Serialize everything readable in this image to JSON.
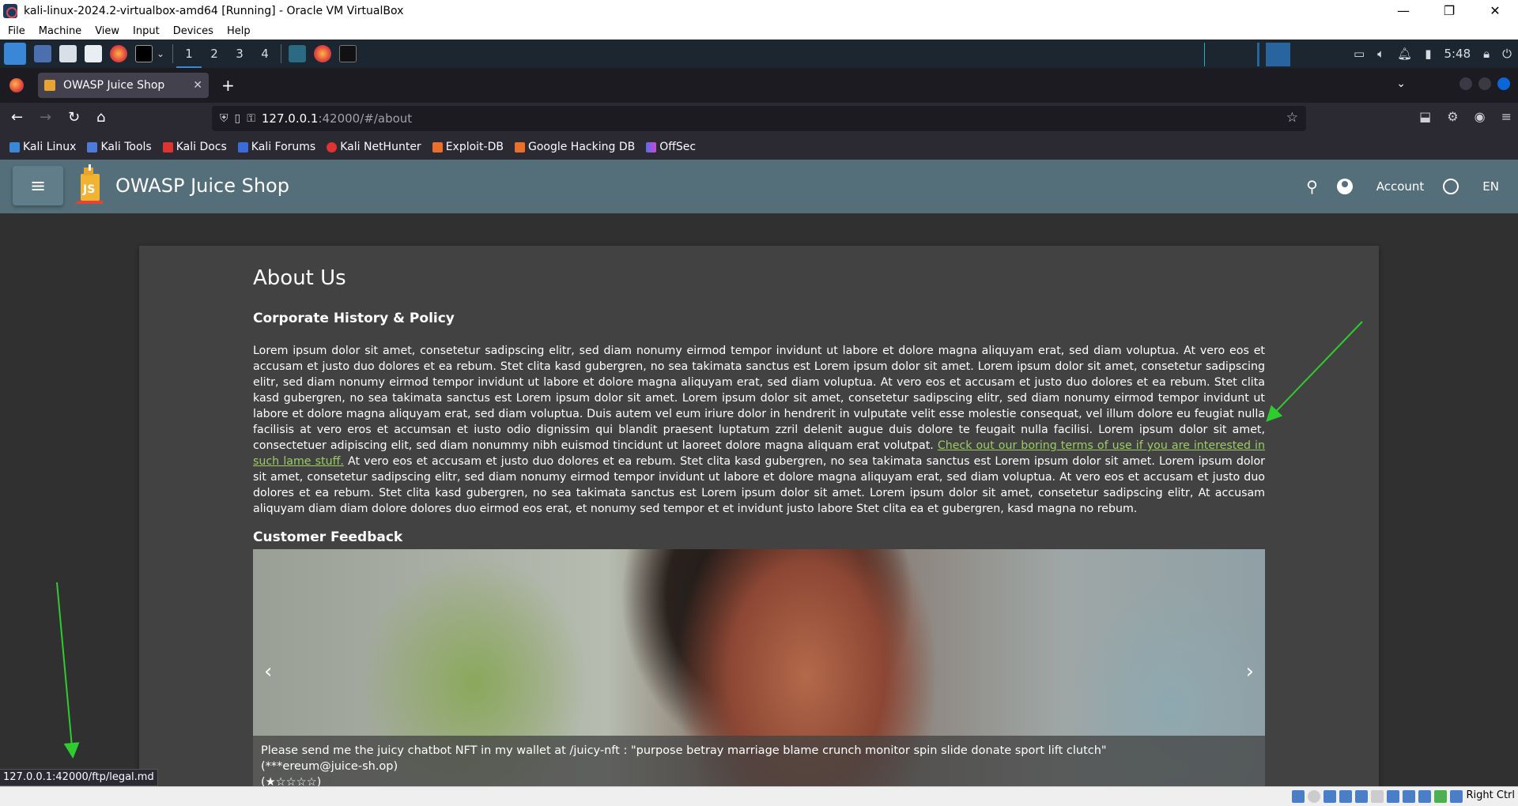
{
  "vbox": {
    "title": "kali-linux-2024.2-virtualbox-amd64 [Running] - Oracle VM VirtualBox",
    "menu": [
      "File",
      "Machine",
      "View",
      "Input",
      "Devices",
      "Help"
    ],
    "host_key": "Right Ctrl"
  },
  "panel": {
    "workspaces": [
      "1",
      "2",
      "3",
      "4"
    ],
    "clock": "5:48"
  },
  "browser": {
    "tab_title": "OWASP Juice Shop",
    "url_host": "127.0.0.1",
    "url_rest": ":42000/#/about",
    "bookmarks": [
      "Kali Linux",
      "Kali Tools",
      "Kali Docs",
      "Kali Forums",
      "Kali NetHunter",
      "Exploit-DB",
      "Google Hacking DB",
      "OffSec"
    ],
    "status_url": "127.0.0.1:42000/ftp/legal.md"
  },
  "shop": {
    "title": "OWASP Juice Shop",
    "account": "Account",
    "language": "EN"
  },
  "about": {
    "title": "About Us",
    "history_heading": "Corporate History & Policy",
    "para_before": "Lorem ipsum dolor sit amet, consetetur sadipscing elitr, sed diam nonumy eirmod tempor invidunt ut labore et dolore magna aliquyam erat, sed diam voluptua. At vero eos et accusam et justo duo dolores et ea rebum. Stet clita kasd gubergren, no sea takimata sanctus est Lorem ipsum dolor sit amet. Lorem ipsum dolor sit amet, consetetur sadipscing elitr, sed diam nonumy eirmod tempor invidunt ut labore et dolore magna aliquyam erat, sed diam voluptua. At vero eos et accusam et justo duo dolores et ea rebum. Stet clita kasd gubergren, no sea takimata sanctus est Lorem ipsum dolor sit amet. Lorem ipsum dolor sit amet, consetetur sadipscing elitr, sed diam nonumy eirmod tempor invidunt ut labore et dolore magna aliquyam erat, sed diam voluptua. Duis autem vel eum iriure dolor in hendrerit in vulputate velit esse molestie consequat, vel illum dolore eu feugiat nulla facilisis at vero eros et accumsan et iusto odio dignissim qui blandit praesent luptatum zzril delenit augue duis dolore te feugait nulla facilisi. Lorem ipsum dolor sit amet, consectetuer adipiscing elit, sed diam nonummy nibh euismod tincidunt ut laoreet dolore magna aliquam erat volutpat. ",
    "terms_link": "Check out our boring terms of use if you are interested in such lame stuff.",
    "para_after": " At vero eos et accusam et justo duo dolores et ea rebum. Stet clita kasd gubergren, no sea takimata sanctus est Lorem ipsum dolor sit amet. Lorem ipsum dolor sit amet, consetetur sadipscing elitr, sed diam nonumy eirmod tempor invidunt ut labore et dolore magna aliquyam erat, sed diam voluptua. At vero eos et accusam et justo duo dolores et ea rebum. Stet clita kasd gubergren, no sea takimata sanctus est Lorem ipsum dolor sit amet. Lorem ipsum dolor sit amet, consetetur sadipscing elitr, At accusam aliquyam diam diam dolore dolores duo eirmod eos erat, et nonumy sed tempor et et invidunt justo labore Stet clita ea et gubergren, kasd magna no rebum.",
    "feedback_heading": "Customer Feedback",
    "feedback_text": "Please send me the juicy chatbot NFT in my wallet at /juicy-nft : \"purpose betray marriage blame crunch monitor spin slide donate sport lift clutch\"",
    "feedback_author": "(***ereum@juice-sh.op)",
    "feedback_rating": "(★☆☆☆☆)",
    "rating_value": 1,
    "rating_max": 5
  },
  "colors": {
    "toolbar": "#546e7a",
    "card": "#424242",
    "link": "#9ccc65",
    "annotation_arrow": "#2ecc2e"
  }
}
